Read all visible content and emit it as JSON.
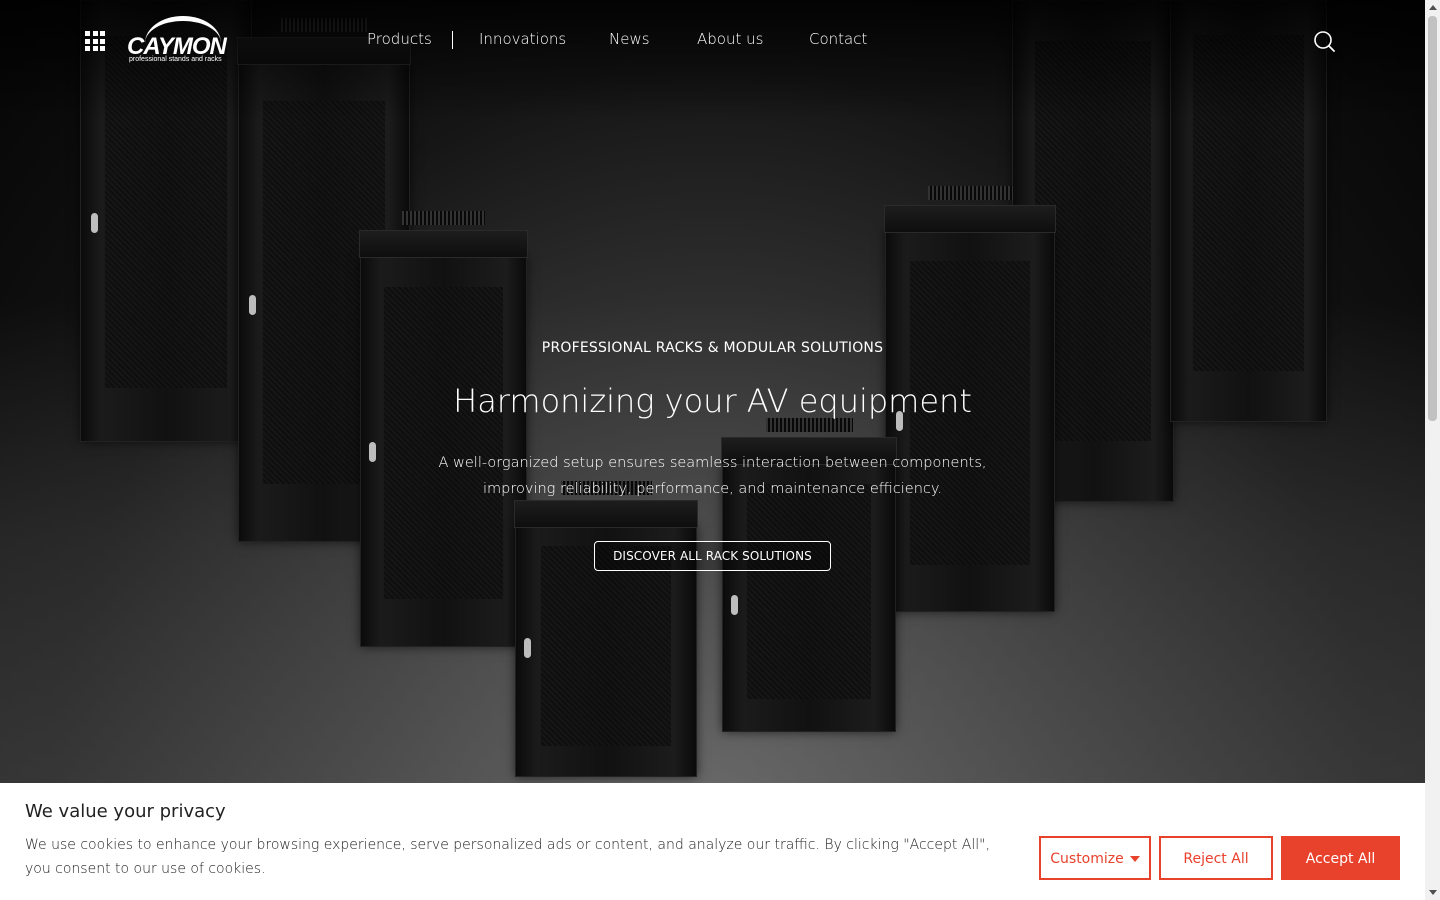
{
  "header": {
    "logo_word": "CAYMON",
    "logo_tagline": "professional stands and racks",
    "nav": [
      "Products",
      "Innovations",
      "News",
      "About us",
      "Contact"
    ]
  },
  "hero": {
    "eyebrow": "PROFESSIONAL RACKS & MODULAR SOLUTIONS",
    "headline": "Harmonizing your AV equipment",
    "subtext_line1": "A well-organized setup ensures seamless interaction between components,",
    "subtext_line2": "improving reliability, performance, and maintenance efficiency.",
    "cta": "DISCOVER ALL RACK SOLUTIONS"
  },
  "cookie": {
    "title": "We value your privacy",
    "message": "We use cookies to enhance your browsing experience, serve personalized ads or content, and analyze our traffic. By clicking \"Accept All\", you consent to our use of cookies.",
    "customize": "Customize",
    "reject": "Reject All",
    "accept": "Accept All"
  },
  "colors": {
    "accent": "#e8412c",
    "text_dark": "#212121",
    "hero_text": "#ffffff"
  },
  "icons": {
    "menu": "grid-menu-icon",
    "search": "search-icon",
    "dropdown": "caret-down-icon"
  }
}
